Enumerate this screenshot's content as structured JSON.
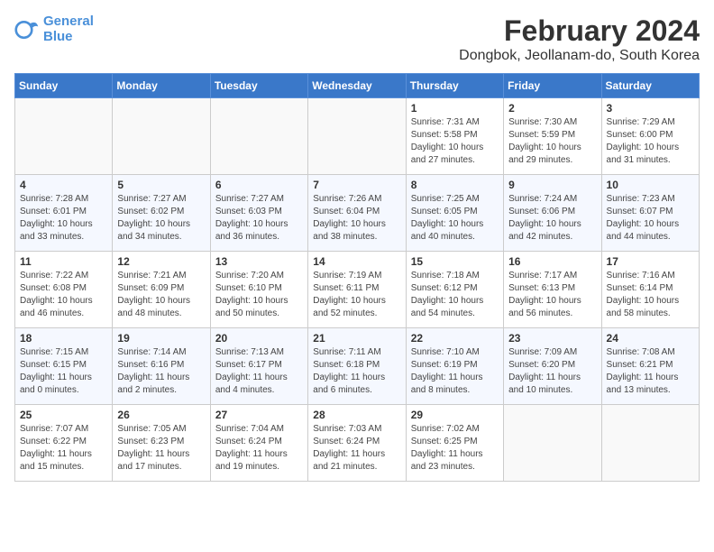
{
  "header": {
    "logo_line1": "General",
    "logo_line2": "Blue",
    "title": "February 2024",
    "subtitle": "Dongbok, Jeollanam-do, South Korea"
  },
  "weekdays": [
    "Sunday",
    "Monday",
    "Tuesday",
    "Wednesday",
    "Thursday",
    "Friday",
    "Saturday"
  ],
  "weeks": [
    [
      {
        "day": "",
        "info": ""
      },
      {
        "day": "",
        "info": ""
      },
      {
        "day": "",
        "info": ""
      },
      {
        "day": "",
        "info": ""
      },
      {
        "day": "1",
        "info": "Sunrise: 7:31 AM\nSunset: 5:58 PM\nDaylight: 10 hours\nand 27 minutes."
      },
      {
        "day": "2",
        "info": "Sunrise: 7:30 AM\nSunset: 5:59 PM\nDaylight: 10 hours\nand 29 minutes."
      },
      {
        "day": "3",
        "info": "Sunrise: 7:29 AM\nSunset: 6:00 PM\nDaylight: 10 hours\nand 31 minutes."
      }
    ],
    [
      {
        "day": "4",
        "info": "Sunrise: 7:28 AM\nSunset: 6:01 PM\nDaylight: 10 hours\nand 33 minutes."
      },
      {
        "day": "5",
        "info": "Sunrise: 7:27 AM\nSunset: 6:02 PM\nDaylight: 10 hours\nand 34 minutes."
      },
      {
        "day": "6",
        "info": "Sunrise: 7:27 AM\nSunset: 6:03 PM\nDaylight: 10 hours\nand 36 minutes."
      },
      {
        "day": "7",
        "info": "Sunrise: 7:26 AM\nSunset: 6:04 PM\nDaylight: 10 hours\nand 38 minutes."
      },
      {
        "day": "8",
        "info": "Sunrise: 7:25 AM\nSunset: 6:05 PM\nDaylight: 10 hours\nand 40 minutes."
      },
      {
        "day": "9",
        "info": "Sunrise: 7:24 AM\nSunset: 6:06 PM\nDaylight: 10 hours\nand 42 minutes."
      },
      {
        "day": "10",
        "info": "Sunrise: 7:23 AM\nSunset: 6:07 PM\nDaylight: 10 hours\nand 44 minutes."
      }
    ],
    [
      {
        "day": "11",
        "info": "Sunrise: 7:22 AM\nSunset: 6:08 PM\nDaylight: 10 hours\nand 46 minutes."
      },
      {
        "day": "12",
        "info": "Sunrise: 7:21 AM\nSunset: 6:09 PM\nDaylight: 10 hours\nand 48 minutes."
      },
      {
        "day": "13",
        "info": "Sunrise: 7:20 AM\nSunset: 6:10 PM\nDaylight: 10 hours\nand 50 minutes."
      },
      {
        "day": "14",
        "info": "Sunrise: 7:19 AM\nSunset: 6:11 PM\nDaylight: 10 hours\nand 52 minutes."
      },
      {
        "day": "15",
        "info": "Sunrise: 7:18 AM\nSunset: 6:12 PM\nDaylight: 10 hours\nand 54 minutes."
      },
      {
        "day": "16",
        "info": "Sunrise: 7:17 AM\nSunset: 6:13 PM\nDaylight: 10 hours\nand 56 minutes."
      },
      {
        "day": "17",
        "info": "Sunrise: 7:16 AM\nSunset: 6:14 PM\nDaylight: 10 hours\nand 58 minutes."
      }
    ],
    [
      {
        "day": "18",
        "info": "Sunrise: 7:15 AM\nSunset: 6:15 PM\nDaylight: 11 hours\nand 0 minutes."
      },
      {
        "day": "19",
        "info": "Sunrise: 7:14 AM\nSunset: 6:16 PM\nDaylight: 11 hours\nand 2 minutes."
      },
      {
        "day": "20",
        "info": "Sunrise: 7:13 AM\nSunset: 6:17 PM\nDaylight: 11 hours\nand 4 minutes."
      },
      {
        "day": "21",
        "info": "Sunrise: 7:11 AM\nSunset: 6:18 PM\nDaylight: 11 hours\nand 6 minutes."
      },
      {
        "day": "22",
        "info": "Sunrise: 7:10 AM\nSunset: 6:19 PM\nDaylight: 11 hours\nand 8 minutes."
      },
      {
        "day": "23",
        "info": "Sunrise: 7:09 AM\nSunset: 6:20 PM\nDaylight: 11 hours\nand 10 minutes."
      },
      {
        "day": "24",
        "info": "Sunrise: 7:08 AM\nSunset: 6:21 PM\nDaylight: 11 hours\nand 13 minutes."
      }
    ],
    [
      {
        "day": "25",
        "info": "Sunrise: 7:07 AM\nSunset: 6:22 PM\nDaylight: 11 hours\nand 15 minutes."
      },
      {
        "day": "26",
        "info": "Sunrise: 7:05 AM\nSunset: 6:23 PM\nDaylight: 11 hours\nand 17 minutes."
      },
      {
        "day": "27",
        "info": "Sunrise: 7:04 AM\nSunset: 6:24 PM\nDaylight: 11 hours\nand 19 minutes."
      },
      {
        "day": "28",
        "info": "Sunrise: 7:03 AM\nSunset: 6:24 PM\nDaylight: 11 hours\nand 21 minutes."
      },
      {
        "day": "29",
        "info": "Sunrise: 7:02 AM\nSunset: 6:25 PM\nDaylight: 11 hours\nand 23 minutes."
      },
      {
        "day": "",
        "info": ""
      },
      {
        "day": "",
        "info": ""
      }
    ]
  ]
}
